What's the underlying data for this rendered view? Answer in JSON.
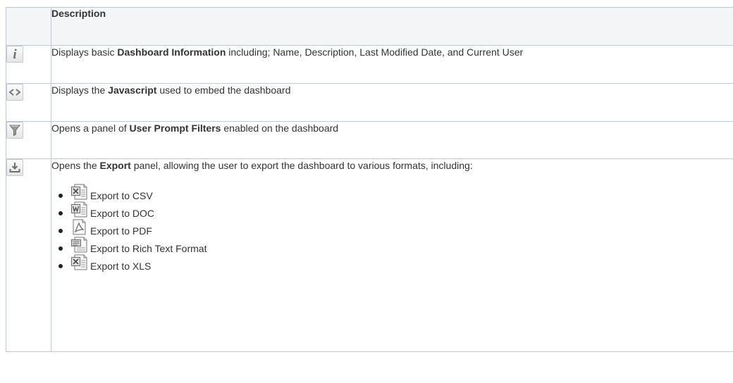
{
  "header": {
    "icon_col": "",
    "description_col": "Description"
  },
  "rows": [
    {
      "icon": "info-icon",
      "glyph": "i",
      "text_before": "Displays basic ",
      "bold": "Dashboard Information",
      "text_after": " including; Name, Description, Last Modified Date, and Current User"
    },
    {
      "icon": "embed-code-icon",
      "glyph": "<>",
      "text_before": "Displays the ",
      "bold": "Javascript",
      "text_after": " used to embed the dashboard"
    },
    {
      "icon": "filter-funnel-icon",
      "text_before": "Opens a panel of ",
      "bold": "User Prompt Filters",
      "text_after": " enabled on the dashboard"
    },
    {
      "icon": "download-icon",
      "text_before": "Opens the ",
      "bold": "Export",
      "text_after": " panel, allowing the user to export the dashboard to various formats, including:"
    }
  ],
  "export_items": [
    {
      "icon": "excel-file-icon",
      "label": "Export to CSV"
    },
    {
      "icon": "word-file-icon",
      "label": "Export to DOC"
    },
    {
      "icon": "pdf-file-icon",
      "label": "Export to PDF"
    },
    {
      "icon": "rtf-file-icon",
      "label": "Export to Rich Text Format"
    },
    {
      "icon": "excel-file-icon",
      "label": "Export to XLS"
    }
  ],
  "colors": {
    "border": "#c1c7d0",
    "header_bg": "#f4f5f7",
    "text": "#333333"
  }
}
